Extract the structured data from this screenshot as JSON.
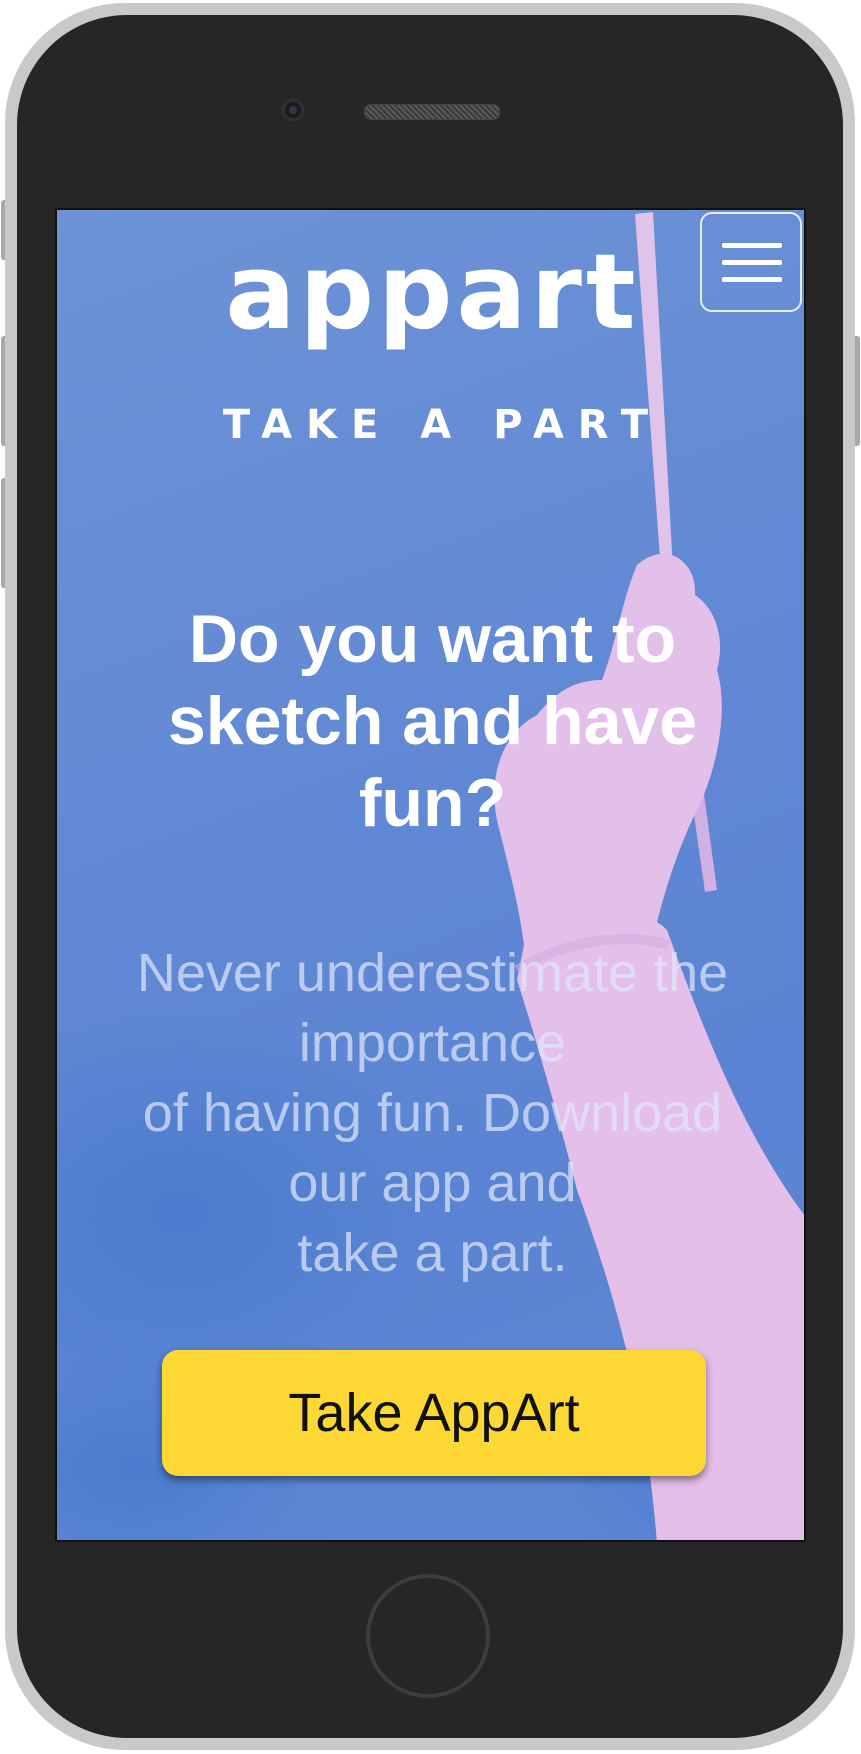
{
  "app": {
    "logo": "appart",
    "tagline": "TAKE A PART"
  },
  "hero": {
    "headline": "Do you want to sketch and have fun?",
    "subtext_lines": [
      "Never underestimate the importance",
      "of having fun. Download our app and",
      "take a part."
    ],
    "cta_label": "Take AppArt"
  },
  "icons": {
    "menu": "hamburger-menu-icon"
  },
  "colors": {
    "background": "#6289d4",
    "arm": "#e4bfe9",
    "cta": "#fdd733",
    "text": "#ffffff"
  }
}
